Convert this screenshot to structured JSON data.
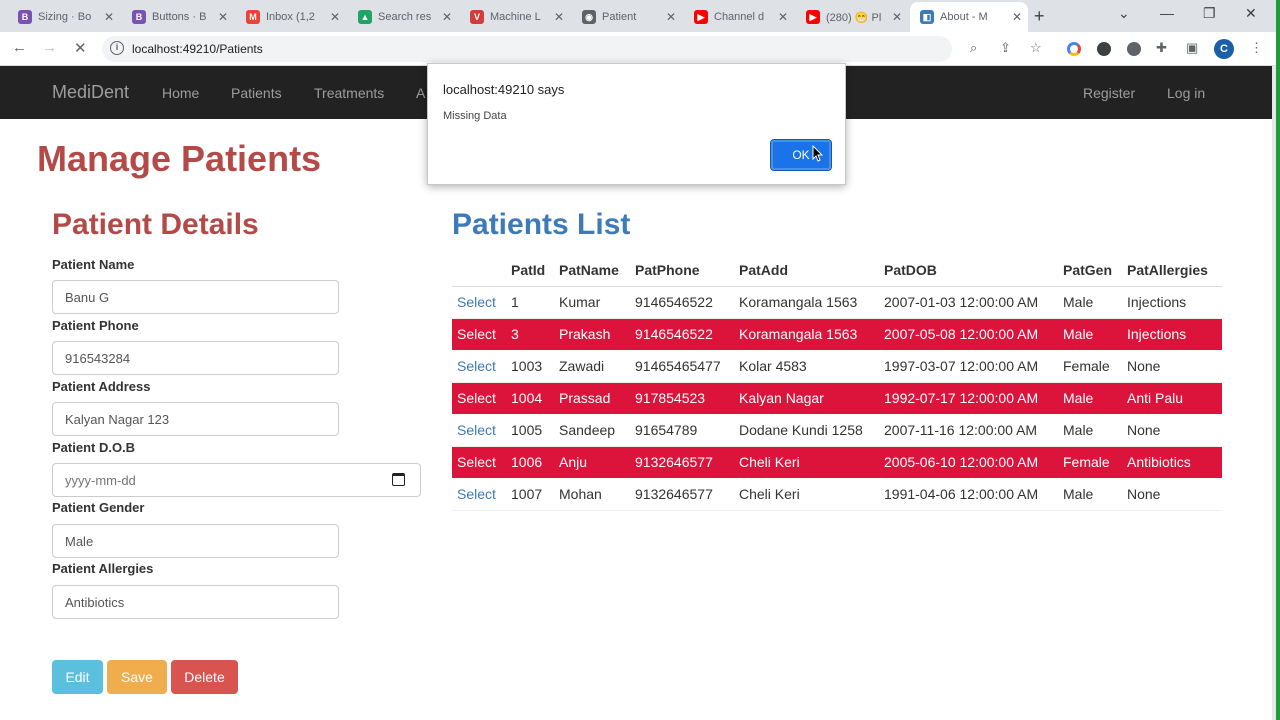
{
  "browser": {
    "tabs": [
      {
        "title": "Sizing · Bo",
        "icon": "bootstrap-icon",
        "color": "#7952b3",
        "glyph": "B"
      },
      {
        "title": "Buttons · B",
        "icon": "bootstrap-icon",
        "color": "#7952b3",
        "glyph": "B"
      },
      {
        "title": "Inbox (1,2",
        "icon": "gmail-icon",
        "color": "#ea4335",
        "glyph": "M"
      },
      {
        "title": "Search res",
        "icon": "drive-icon",
        "color": "#1fa463",
        "glyph": "▲"
      },
      {
        "title": "Machine L",
        "icon": "vivaldi-icon",
        "color": "#d63a3a",
        "glyph": "V"
      },
      {
        "title": "Patient",
        "icon": "globe-icon",
        "color": "#5f6368",
        "glyph": "◉"
      },
      {
        "title": "Channel d",
        "icon": "youtube-icon",
        "color": "#ff0000",
        "glyph": "▶"
      },
      {
        "title": "(280) 😁 Pl",
        "icon": "youtube-icon",
        "color": "#ff0000",
        "glyph": "▶"
      },
      {
        "title": "About - M",
        "icon": "site-icon",
        "color": "#3d7ab8",
        "glyph": "◧"
      }
    ],
    "url": "localhost:49210/Patients"
  },
  "navbar": {
    "brand": "MediDent",
    "links": [
      "Home",
      "Patients",
      "Treatments",
      "A"
    ],
    "register": "Register",
    "login": "Log in"
  },
  "page": {
    "title": "Manage Patients",
    "details_title": "Patient Details",
    "list_title": "Patients List"
  },
  "form": {
    "name_label": "Patient Name",
    "name_value": "Banu G",
    "phone_label": "Patient Phone",
    "phone_value": "916543284",
    "address_label": "Patient Address",
    "address_value": "Kalyan Nagar 123",
    "dob_label": "Patient D.O.B",
    "dob_placeholder": "yyyy-mm-dd",
    "gender_label": "Patient Gender",
    "gender_value": "Male",
    "allergies_label": "Patient Allergies",
    "allergies_value": "Antibiotics",
    "edit_label": "Edit",
    "save_label": "Save",
    "delete_label": "Delete"
  },
  "table": {
    "select_label": "Select",
    "headers": [
      "PatId",
      "PatName",
      "PatPhone",
      "PatAdd",
      "PatDOB",
      "PatGen",
      "PatAllergies"
    ],
    "rows": [
      [
        "1",
        "Kumar",
        "9146546522",
        "Koramangala 1563",
        "2007-01-03 12:00:00 AM",
        "Male",
        "Injections"
      ],
      [
        "3",
        "Prakash",
        "9146546522",
        "Koramangala 1563",
        "2007-05-08 12:00:00 AM",
        "Male",
        "Injections"
      ],
      [
        "1003",
        "Zawadi",
        "91465465477",
        "Kolar 4583",
        "1997-03-07 12:00:00 AM",
        "Female",
        "None"
      ],
      [
        "1004",
        "Prassad",
        "917854523",
        "Kalyan Nagar",
        "1992-07-17 12:00:00 AM",
        "Male",
        "Anti Palu"
      ],
      [
        "1005",
        "Sandeep",
        "91654789",
        "Dodane Kundi 1258",
        "2007-11-16 12:00:00 AM",
        "Male",
        "None"
      ],
      [
        "1006",
        "Anju",
        "9132646577",
        "Cheli Keri",
        "2005-06-10 12:00:00 AM",
        "Female",
        "Antibiotics"
      ],
      [
        "1007",
        "Mohan",
        "9132646577",
        "Cheli Keri",
        "1991-04-06 12:00:00 AM",
        "Male",
        "None"
      ]
    ],
    "alt_row_color": "#dc143c"
  },
  "dialog": {
    "title": "localhost:49210 says",
    "message": "Missing Data",
    "ok_label": "OK"
  }
}
